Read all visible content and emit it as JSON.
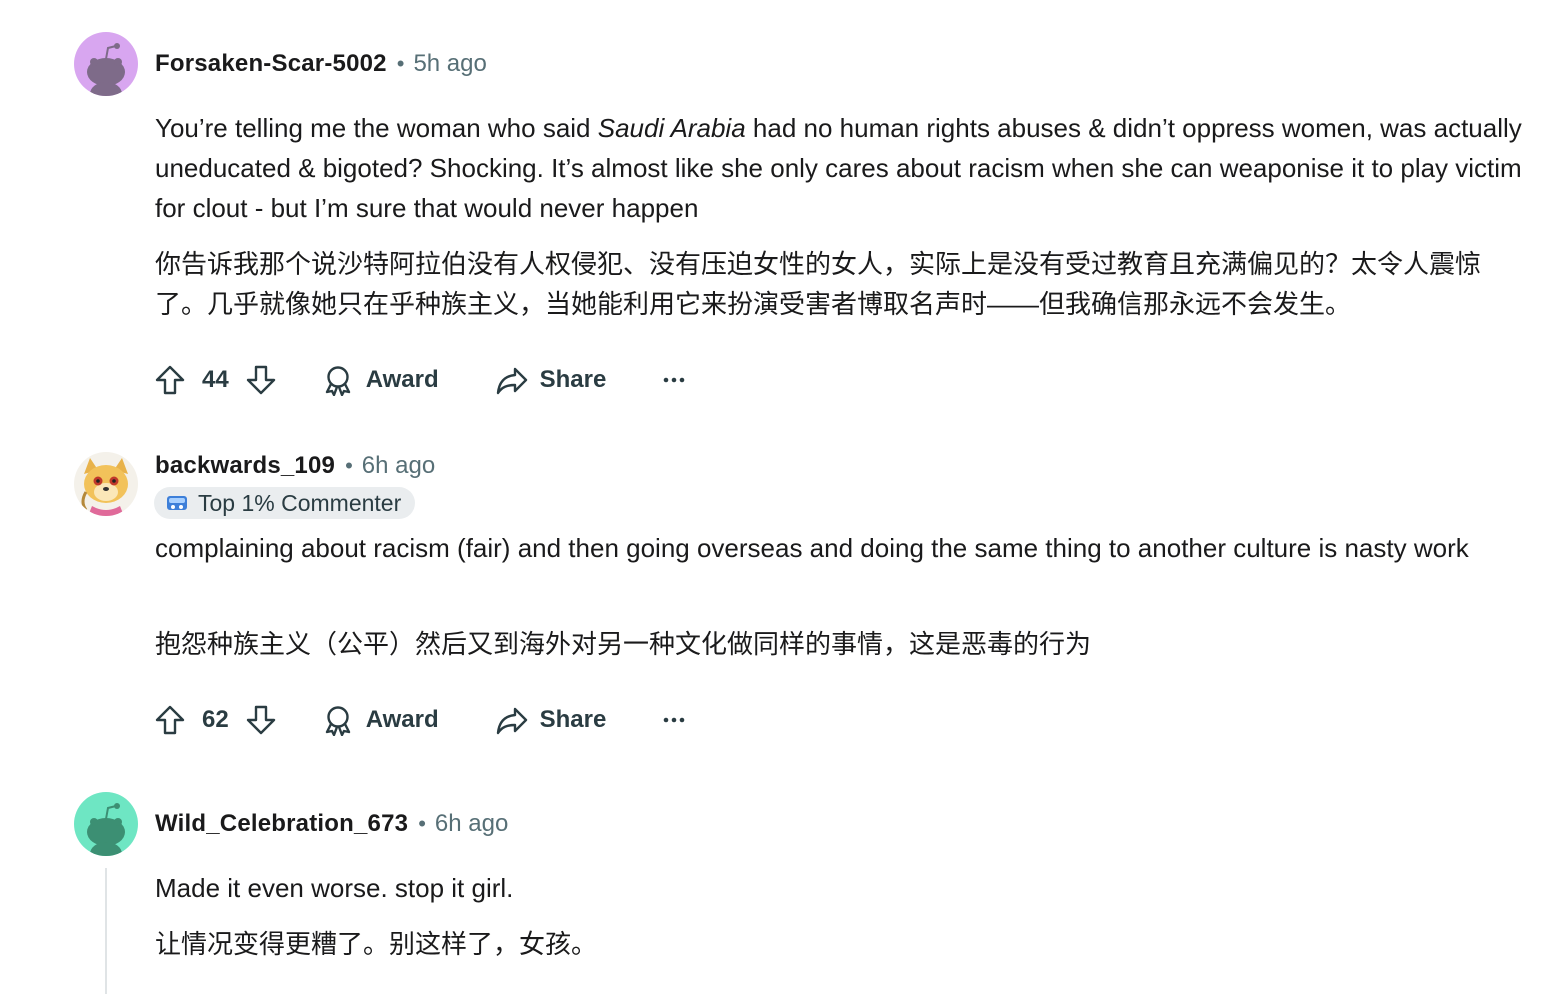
{
  "comments": [
    {
      "username": "Forsaken-Scar-5002",
      "time": "5h ago",
      "body_parts": [
        "You’re telling me the woman who said ",
        "Saudi Arabia",
        " had no human rights abuses & didn’t oppress women, was actually uneducated & bigoted? Shocking. It’s almost like she only cares about racism when she can weaponise it to play victim for clout - but I’m sure that would never happen"
      ],
      "translation": "你告诉我那个说沙特阿拉伯没有人权侵犯、没有压迫女性的女人，实际上是没有受过教育且充满偏见的？太令人震惊了。几乎就像她只在乎种族主义，当她能利用它来扮演受害者博取名声时——但我确信那永远不会发生。",
      "votes": "44",
      "avatar_color": "#d8a6f0"
    },
    {
      "username": "backwards_109",
      "time": "6h ago",
      "flair": "Top 1% Commenter",
      "body": "complaining about racism (fair) and then going overseas and doing the same thing to another culture is nasty work",
      "translation": "抱怨种族主义（公平）然后又到海外对另一种文化做同样的事情，这是恶毒的行为",
      "votes": "62"
    },
    {
      "username": "Wild_Celebration_673",
      "time": "6h ago",
      "body": "Made it even worse. stop it girl.",
      "translation": "让情况变得更糟了。别这样了，女孩。",
      "avatar_color": "#6ee6c3"
    }
  ],
  "actions": {
    "award_label": "Award",
    "share_label": "Share"
  },
  "icons": [
    "upvote-icon",
    "downvote-icon",
    "award-icon",
    "share-icon",
    "more-icon",
    "snoo-avatar-icon",
    "flair-badge-icon"
  ],
  "colors": {
    "meta_text": "#576f76",
    "action_text": "#2a3c42",
    "flair_bg": "#eaedef"
  }
}
